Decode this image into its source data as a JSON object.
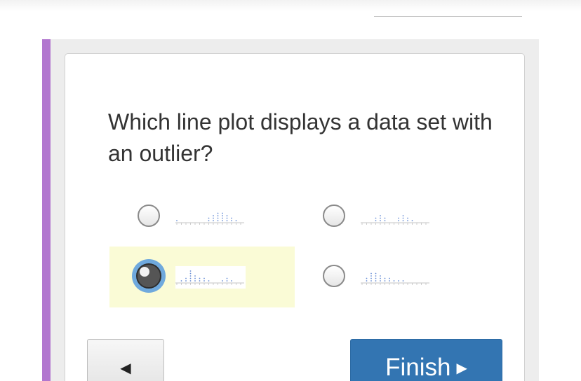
{
  "question": {
    "text": "Which line plot displays a data set with an outlier?"
  },
  "options": [
    {
      "id": "a",
      "selected": false,
      "thumbnail": "line-plot-a"
    },
    {
      "id": "b",
      "selected": false,
      "thumbnail": "line-plot-b"
    },
    {
      "id": "c",
      "selected": true,
      "thumbnail": "line-plot-c"
    },
    {
      "id": "d",
      "selected": false,
      "thumbnail": "line-plot-d"
    }
  ],
  "navigation": {
    "back_icon": "◀",
    "finish_label": "Finish",
    "finish_icon": "▶"
  },
  "colors": {
    "accent_stripe": "#b277cf",
    "selected_highlight": "#fafbd6",
    "primary_button": "#3375b2",
    "radio_focus": "#6fa9dd",
    "plot_dots": "#6b8fd6"
  }
}
